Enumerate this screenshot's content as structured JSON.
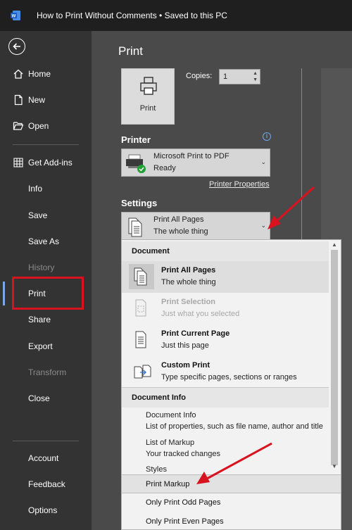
{
  "titlebar": {
    "document_title": "How to Print Without Comments • Saved to this PC",
    "app_icon": "word-logo-icon"
  },
  "sidebar": {
    "back_icon": "back-arrow-icon",
    "items": [
      {
        "label": "Home",
        "icon": "home-icon",
        "enabled": true
      },
      {
        "label": "New",
        "icon": "new-document-icon",
        "enabled": true
      },
      {
        "label": "Open",
        "icon": "open-folder-icon",
        "enabled": true
      },
      {
        "label": "Get Add-ins",
        "icon": "add-ins-grid-icon",
        "enabled": true
      },
      {
        "label": "Info",
        "enabled": true
      },
      {
        "label": "Save",
        "enabled": true
      },
      {
        "label": "Save As",
        "enabled": true
      },
      {
        "label": "History",
        "enabled": false
      },
      {
        "label": "Print",
        "enabled": true,
        "selected": true
      },
      {
        "label": "Share",
        "enabled": true
      },
      {
        "label": "Export",
        "enabled": true
      },
      {
        "label": "Transform",
        "enabled": false
      },
      {
        "label": "Close",
        "enabled": true
      }
    ],
    "bottom_items": [
      {
        "label": "Account"
      },
      {
        "label": "Feedback"
      },
      {
        "label": "Options"
      }
    ]
  },
  "print": {
    "title": "Print",
    "print_button_label": "Print",
    "copies_label": "Copies:",
    "copies_value": "1"
  },
  "printer": {
    "heading": "Printer",
    "info_icon": "info-icon",
    "name": "Microsoft Print to PDF",
    "status": "Ready",
    "properties_link": "Printer Properties"
  },
  "settings": {
    "heading": "Settings",
    "selected_title": "Print All Pages",
    "selected_subtitle": "The whole thing"
  },
  "menu": {
    "document_header": "Document",
    "document_options": [
      {
        "title": "Print All Pages",
        "subtitle": "The whole thing",
        "selected": true,
        "enabled": true,
        "icon": "all-pages-icon"
      },
      {
        "title": "Print Selection",
        "subtitle": "Just what you selected",
        "selected": false,
        "enabled": false,
        "icon": "selection-icon"
      },
      {
        "title": "Print Current Page",
        "subtitle": "Just this page",
        "selected": false,
        "enabled": true,
        "icon": "current-page-icon"
      },
      {
        "title": "Custom Print",
        "subtitle": "Type specific pages, sections or ranges",
        "selected": false,
        "enabled": true,
        "icon": "custom-print-icon"
      }
    ],
    "info_header": "Document Info",
    "info_items": [
      {
        "title": "Document Info",
        "subtitle": "List of properties, such as file name, author and title"
      },
      {
        "title": "List of Markup",
        "subtitle": "Your tracked changes"
      },
      {
        "title": "Styles",
        "subtitle": ""
      }
    ],
    "toggle_items": [
      {
        "label": "Print Markup",
        "highlighted": true
      },
      {
        "label": "Only Print Odd Pages",
        "highlighted": false
      },
      {
        "label": "Only Print Even Pages",
        "highlighted": false
      }
    ]
  },
  "annotations": {
    "color": "#d9121f"
  }
}
